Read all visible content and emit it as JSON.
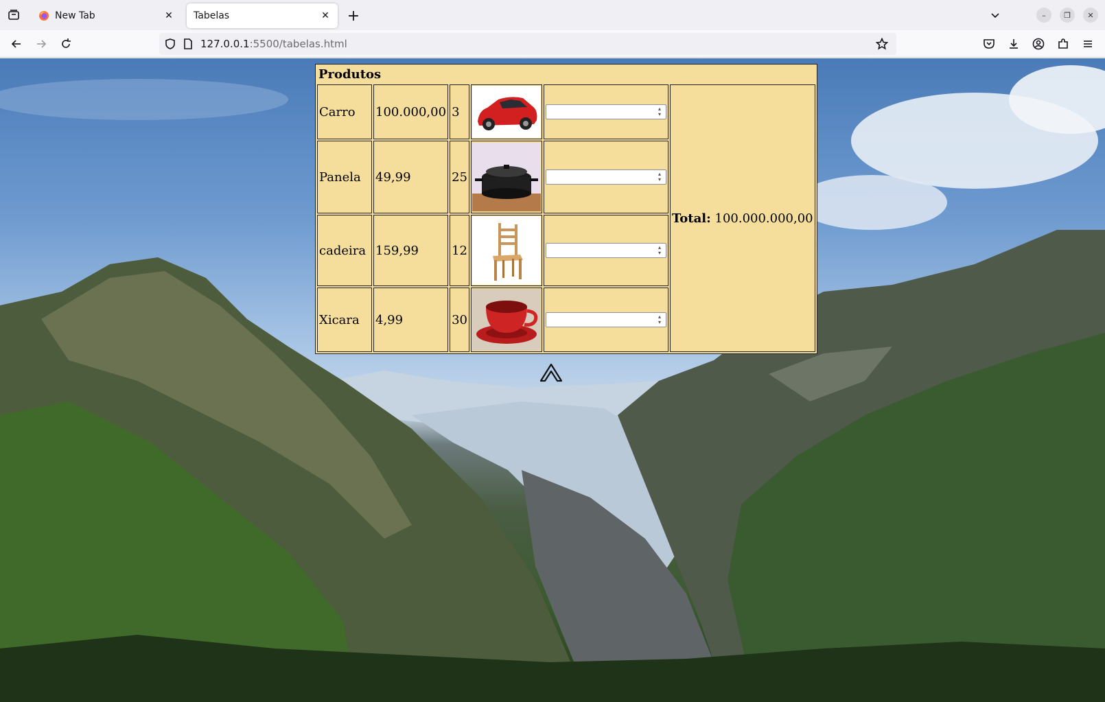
{
  "browser": {
    "tabs": [
      {
        "title": "New Tab",
        "active": false
      },
      {
        "title": "Tabelas",
        "active": true
      }
    ],
    "url_host": "127.0.0.1",
    "url_path": ":5500/tabelas.html"
  },
  "table": {
    "caption": "Produtos",
    "rows": [
      {
        "name": "Carro",
        "price": "100.000,00",
        "qty": "3",
        "image": "red-car",
        "input_value": ""
      },
      {
        "name": "Panela",
        "price": "49,99",
        "qty": "25",
        "image": "cooking-pot",
        "input_value": ""
      },
      {
        "name": "cadeira",
        "price": "159,99",
        "qty": "12",
        "image": "wooden-chair",
        "input_value": ""
      },
      {
        "name": "Xicara",
        "price": "4,99",
        "qty": "30",
        "image": "red-cup",
        "input_value": ""
      }
    ],
    "total_label": "Total:",
    "total_value": "100.000.000,00"
  },
  "colors": {
    "table_bg": "#f5de9b",
    "tab_bg": "#f0f0f4"
  }
}
